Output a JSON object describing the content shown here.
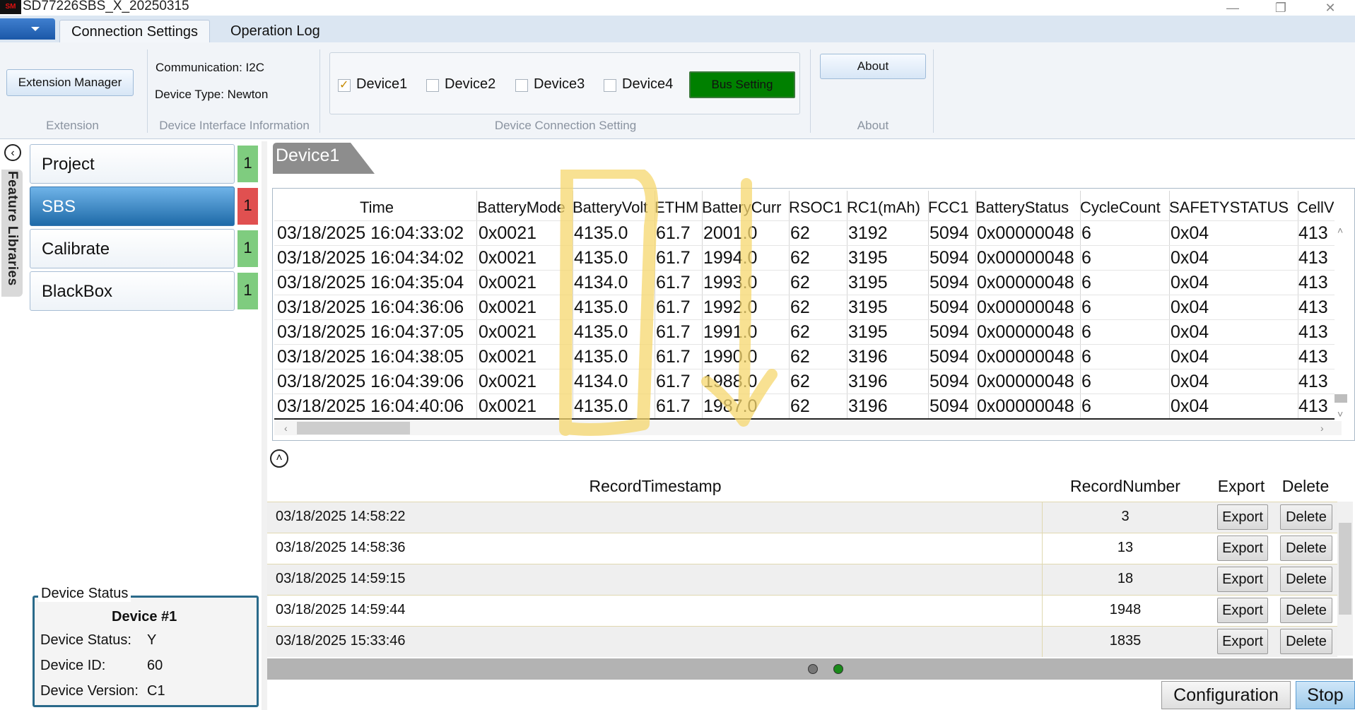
{
  "window": {
    "logo_text": "SM",
    "title": "SD77226SBS_X_20250315",
    "minimize_glyph": "—",
    "restore_glyph": "❐",
    "close_glyph": "✕"
  },
  "ribbon": {
    "tabs": [
      "Connection Settings",
      "Operation Log"
    ],
    "extension_button": "Extension Manager",
    "extension_group": "Extension",
    "communication": "Communication: I2C",
    "device_type": "Device Type: Newton",
    "interface_group": "Device Interface Information",
    "devices": [
      {
        "label": "Device1",
        "checked": true
      },
      {
        "label": "Device2",
        "checked": false
      },
      {
        "label": "Device3",
        "checked": false
      },
      {
        "label": "Device4",
        "checked": false
      }
    ],
    "bus_setting": "Bus Setting",
    "connection_group": "Device Connection Setting",
    "about_button": "About",
    "about_group": "About"
  },
  "sidebar": {
    "feature_libraries": "Feature Libraries",
    "collapse_glyph": "‹",
    "items": [
      {
        "label": "Project",
        "badge": "1",
        "badge_color": "#7fcc7f",
        "active": false
      },
      {
        "label": "SBS",
        "badge": "1",
        "badge_color": "#e05050",
        "active": true
      },
      {
        "label": "Calibrate",
        "badge": "1",
        "badge_color": "#7fcc7f",
        "active": false
      },
      {
        "label": "BlackBox",
        "badge": "1",
        "badge_color": "#7fcc7f",
        "active": false
      }
    ]
  },
  "device_status": {
    "legend": "Device Status",
    "device_name": "Device #1",
    "status_label": "Device Status:",
    "status_value": "Y",
    "id_label": "Device ID:",
    "id_value": "60",
    "version_label": "Device Version:",
    "version_value": "C1"
  },
  "device_tab": "Device1",
  "sbs_grid": {
    "columns": [
      "Time",
      "BatteryMode",
      "BatteryVolt",
      "ETHM",
      "BatteryCurr",
      "RSOC1",
      "RC1(mAh)",
      "FCC1",
      "BatteryStatus",
      "CycleCount",
      "SAFETYSTATUS",
      "CellV"
    ],
    "rows": [
      [
        "03/18/2025 16:04:33:02",
        "0x0021",
        "4135.0",
        "61.7",
        "2001.0",
        "62",
        "3192",
        "5094",
        "0x00000048",
        "6",
        "0x04",
        "413"
      ],
      [
        "03/18/2025 16:04:34:02",
        "0x0021",
        "4135.0",
        "61.7",
        "1994.0",
        "62",
        "3195",
        "5094",
        "0x00000048",
        "6",
        "0x04",
        "413"
      ],
      [
        "03/18/2025 16:04:35:04",
        "0x0021",
        "4134.0",
        "61.7",
        "1993.0",
        "62",
        "3195",
        "5094",
        "0x00000048",
        "6",
        "0x04",
        "413"
      ],
      [
        "03/18/2025 16:04:36:06",
        "0x0021",
        "4135.0",
        "61.7",
        "1992.0",
        "62",
        "3195",
        "5094",
        "0x00000048",
        "6",
        "0x04",
        "413"
      ],
      [
        "03/18/2025 16:04:37:05",
        "0x0021",
        "4135.0",
        "61.7",
        "1991.0",
        "62",
        "3195",
        "5094",
        "0x00000048",
        "6",
        "0x04",
        "413"
      ],
      [
        "03/18/2025 16:04:38:05",
        "0x0021",
        "4135.0",
        "61.7",
        "1990.0",
        "62",
        "3196",
        "5094",
        "0x00000048",
        "6",
        "0x04",
        "413"
      ],
      [
        "03/18/2025 16:04:39:06",
        "0x0021",
        "4134.0",
        "61.7",
        "1988.0",
        "62",
        "3196",
        "5094",
        "0x00000048",
        "6",
        "0x04",
        "413"
      ],
      [
        "03/18/2025 16:04:40:06",
        "0x0021",
        "4135.0",
        "61.7",
        "1987.0",
        "62",
        "3196",
        "5094",
        "0x00000048",
        "6",
        "0x04",
        "413"
      ]
    ]
  },
  "records": {
    "columns": [
      "RecordTimestamp",
      "RecordNumber",
      "Export",
      "Delete"
    ],
    "export_label": "Export",
    "delete_label": "Delete",
    "rows": [
      {
        "timestamp": "03/18/2025 14:58:22",
        "number": "3"
      },
      {
        "timestamp": "03/18/2025 14:58:36",
        "number": "13"
      },
      {
        "timestamp": "03/18/2025 14:59:15",
        "number": "18"
      },
      {
        "timestamp": "03/18/2025 14:59:44",
        "number": "1948"
      },
      {
        "timestamp": "03/18/2025 15:33:46",
        "number": "1835"
      }
    ]
  },
  "footer": {
    "configuration": "Configuration",
    "stop": "Stop"
  },
  "colors": {
    "accent_blue": "#1e6aa8",
    "bus_setting_green": "#008000",
    "annotation_yellow": "#f5d76e"
  }
}
